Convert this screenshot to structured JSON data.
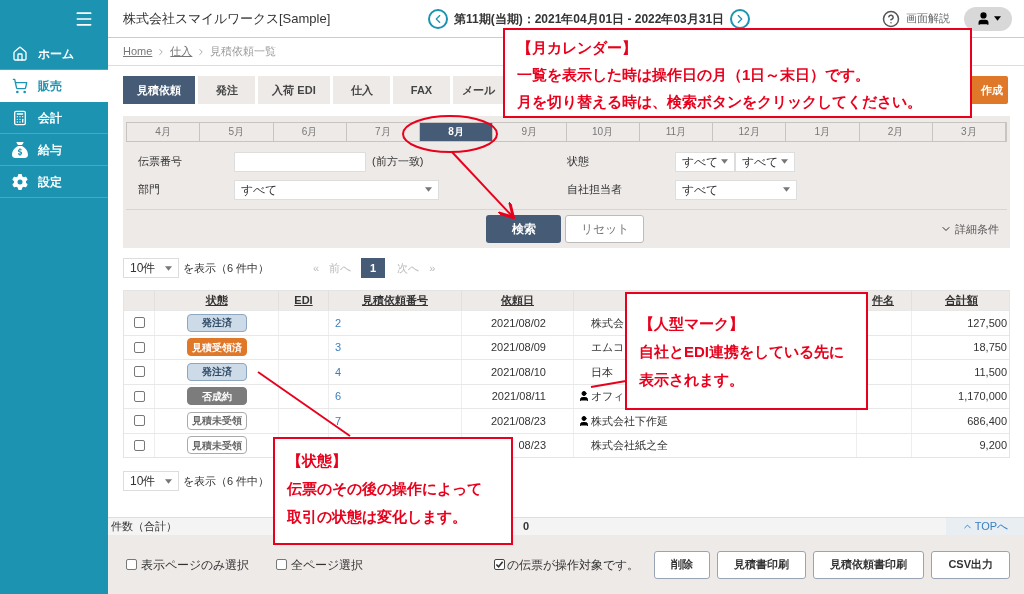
{
  "sidebar": {
    "items": [
      {
        "label": "ホーム",
        "selected": false
      },
      {
        "label": "販売",
        "selected": true
      },
      {
        "label": "会計",
        "selected": false
      },
      {
        "label": "給与",
        "selected": false
      },
      {
        "label": "設定",
        "selected": false
      }
    ]
  },
  "header": {
    "company": "株式会社スマイルワークス[Sample]",
    "period": "第11期(当期)：2021年04月01日 - 2022年03月31日",
    "help": "画面解説"
  },
  "breadcrumb": [
    {
      "label": "Home",
      "link": true
    },
    {
      "label": "仕入",
      "link": true
    },
    {
      "label": "見積依頼一覧",
      "link": false
    }
  ],
  "tabs": [
    {
      "label": "見積依頼",
      "selected": true
    },
    {
      "label": "発注",
      "selected": false
    },
    {
      "label": "入荷 EDI",
      "selected": false
    },
    {
      "label": "仕入",
      "selected": false
    },
    {
      "label": "FAX",
      "selected": false
    },
    {
      "label": "メール",
      "selected": false
    }
  ],
  "create_button": "作成",
  "months": [
    {
      "label": "4月",
      "selected": false
    },
    {
      "label": "5月",
      "selected": false
    },
    {
      "label": "6月",
      "selected": false
    },
    {
      "label": "7月",
      "selected": false
    },
    {
      "label": "8月",
      "selected": true
    },
    {
      "label": "9月",
      "selected": false
    },
    {
      "label": "10月",
      "selected": false
    },
    {
      "label": "11月",
      "selected": false
    },
    {
      "label": "12月",
      "selected": false
    },
    {
      "label": "1月",
      "selected": false
    },
    {
      "label": "2月",
      "selected": false
    },
    {
      "label": "3月",
      "selected": false
    }
  ],
  "filters": {
    "slip_label": "伝票番号",
    "slip_hint": "(前方一致)",
    "dept_label": "部門",
    "dept_value": "すべて",
    "status_label": "状態",
    "status_values": [
      "すべて",
      "すべて"
    ],
    "staff_label": "自社担当者",
    "staff_value": "すべて",
    "search": "検索",
    "reset": "リセット",
    "details": "詳細条件"
  },
  "pager": {
    "per_page": "10件",
    "summary": "を表示（6 件中）",
    "first": {
      "label": "«",
      "disabled": true
    },
    "prev": {
      "label": "前へ",
      "disabled": true
    },
    "pages": [
      {
        "label": "1",
        "selected": true
      }
    ],
    "next": {
      "label": "次へ",
      "disabled": true
    },
    "last": {
      "label": "»",
      "disabled": true
    }
  },
  "table": {
    "columns": [
      "状態",
      "EDI",
      "見積依頼番号",
      "依頼日",
      "件名",
      "合計額"
    ],
    "rows": [
      {
        "checked": false,
        "status": "発注済",
        "kind": "ordered",
        "number": "2",
        "date": "2021/08/02",
        "edi_mark": false,
        "customer": "株式会",
        "amount": "127,500"
      },
      {
        "checked": false,
        "status": "見積受領済",
        "kind": "received",
        "number": "3",
        "date": "2021/08/09",
        "edi_mark": false,
        "customer": "エムコ",
        "amount": "18,750"
      },
      {
        "checked": false,
        "status": "発注済",
        "kind": "ordered",
        "number": "4",
        "date": "2021/08/10",
        "edi_mark": false,
        "customer": "日本",
        "amount": "11,500"
      },
      {
        "checked": false,
        "status": "否成約",
        "kind": "lost",
        "number": "6",
        "date": "2021/08/11",
        "edi_mark": true,
        "customer": "オフィ",
        "amount": "1,170,000"
      },
      {
        "checked": false,
        "status": "見積未受領",
        "kind": "pending",
        "number": "7",
        "date": "2021/08/23",
        "edi_mark": true,
        "customer": "株式会社下作延",
        "amount": "686,400"
      },
      {
        "checked": false,
        "status": "見積未受領",
        "kind": "pending",
        "date": "08/23",
        "edi_mark": false,
        "customer": "株式会社紙之全",
        "amount": "9,200"
      }
    ]
  },
  "pager_bottom": {
    "per_page": "10件",
    "summary": "を表示（6 件中）"
  },
  "totals": {
    "label": "件数（合計）",
    "value": "0",
    "top": "TOPへ"
  },
  "toolbar": {
    "page_only": {
      "label": "表示ページのみ選択",
      "checked": false
    },
    "all_pages": {
      "label": "全ページ選択",
      "checked": false
    },
    "target_note": {
      "label": "の伝票が操作対象です。",
      "checked": true
    },
    "buttons": [
      "削除",
      "見積書印刷",
      "見積依頼書印刷",
      "CSV出力"
    ]
  },
  "callouts": [
    {
      "title": "【月カレンダー】",
      "lines": [
        "一覧を表示した時は操作日の月（1日～末日）です。",
        "月を切り替える時は、検索ボタンをクリックしてください。"
      ]
    },
    {
      "title": "【人型マーク】",
      "lines": [
        "自社とEDI連携をしている先に",
        "表示されます。"
      ]
    },
    {
      "title": "【状態】",
      "lines": [
        "伝票のその後の操作によって",
        "取引の状態は変化します。"
      ]
    }
  ]
}
